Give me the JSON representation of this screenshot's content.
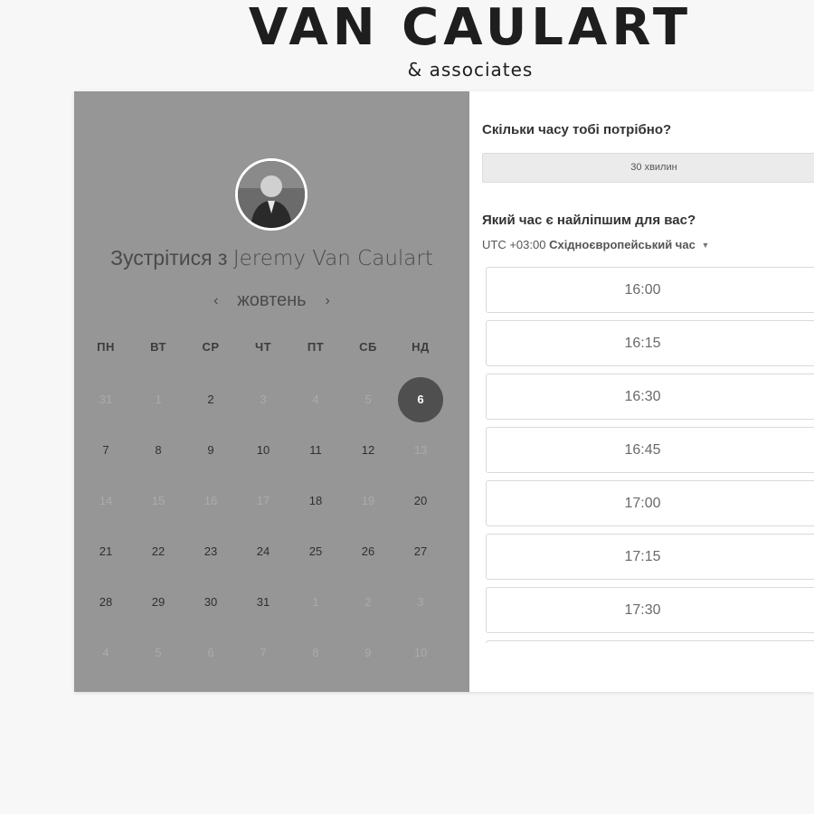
{
  "brand": {
    "title": "VAN CAULART",
    "subtitle": "& associates"
  },
  "calendar": {
    "meet_prefix": "Зустрітися з",
    "host_name": "Jeremy Van Caulart",
    "avatar_icon": "person-photo",
    "month_label": "жовтень",
    "prev_icon": "chevron-left-icon",
    "next_icon": "chevron-right-icon",
    "weekdays": [
      "ПН",
      "ВТ",
      "СР",
      "ЧТ",
      "ПТ",
      "СБ",
      "НД"
    ],
    "weeks": [
      [
        {
          "d": "31",
          "s": "muted"
        },
        {
          "d": "1",
          "s": "muted"
        },
        {
          "d": "2",
          "s": "active"
        },
        {
          "d": "3",
          "s": "muted"
        },
        {
          "d": "4",
          "s": "muted"
        },
        {
          "d": "5",
          "s": "muted"
        },
        {
          "d": "6",
          "s": "selected"
        }
      ],
      [
        {
          "d": "7",
          "s": "active"
        },
        {
          "d": "8",
          "s": "active"
        },
        {
          "d": "9",
          "s": "active"
        },
        {
          "d": "10",
          "s": "active"
        },
        {
          "d": "11",
          "s": "active"
        },
        {
          "d": "12",
          "s": "active"
        },
        {
          "d": "13",
          "s": "muted"
        }
      ],
      [
        {
          "d": "14",
          "s": "muted"
        },
        {
          "d": "15",
          "s": "muted"
        },
        {
          "d": "16",
          "s": "muted"
        },
        {
          "d": "17",
          "s": "muted"
        },
        {
          "d": "18",
          "s": "active"
        },
        {
          "d": "19",
          "s": "muted"
        },
        {
          "d": "20",
          "s": "active"
        }
      ],
      [
        {
          "d": "21",
          "s": "active"
        },
        {
          "d": "22",
          "s": "active"
        },
        {
          "d": "23",
          "s": "active"
        },
        {
          "d": "24",
          "s": "active"
        },
        {
          "d": "25",
          "s": "active"
        },
        {
          "d": "26",
          "s": "active"
        },
        {
          "d": "27",
          "s": "active"
        }
      ],
      [
        {
          "d": "28",
          "s": "active"
        },
        {
          "d": "29",
          "s": "active"
        },
        {
          "d": "30",
          "s": "active"
        },
        {
          "d": "31",
          "s": "active"
        },
        {
          "d": "1",
          "s": "muted"
        },
        {
          "d": "2",
          "s": "muted"
        },
        {
          "d": "3",
          "s": "muted"
        }
      ],
      [
        {
          "d": "4",
          "s": "muted"
        },
        {
          "d": "5",
          "s": "muted"
        },
        {
          "d": "6",
          "s": "muted"
        },
        {
          "d": "7",
          "s": "muted"
        },
        {
          "d": "8",
          "s": "muted"
        },
        {
          "d": "9",
          "s": "muted"
        },
        {
          "d": "10",
          "s": "muted"
        }
      ]
    ],
    "selected_day": "6"
  },
  "booking": {
    "duration_question": "Скільки часу тобі потрібно?",
    "duration_value": "30 хвилин",
    "time_question": "Який час є найліпшим для вас?",
    "timezone_offset": "UTC +03:00",
    "timezone_name": "Східноєвропейський час",
    "timezone_caret_icon": "caret-down-icon",
    "time_slots": [
      "16:00",
      "16:15",
      "16:30",
      "16:45",
      "17:00",
      "17:15",
      "17:30",
      ""
    ]
  },
  "colors": {
    "page_bg": "#f7f7f7",
    "left_panel_bg": "#969696",
    "selected_day_bg": "#4f4f4f",
    "brand_text": "#1e1e1e"
  }
}
